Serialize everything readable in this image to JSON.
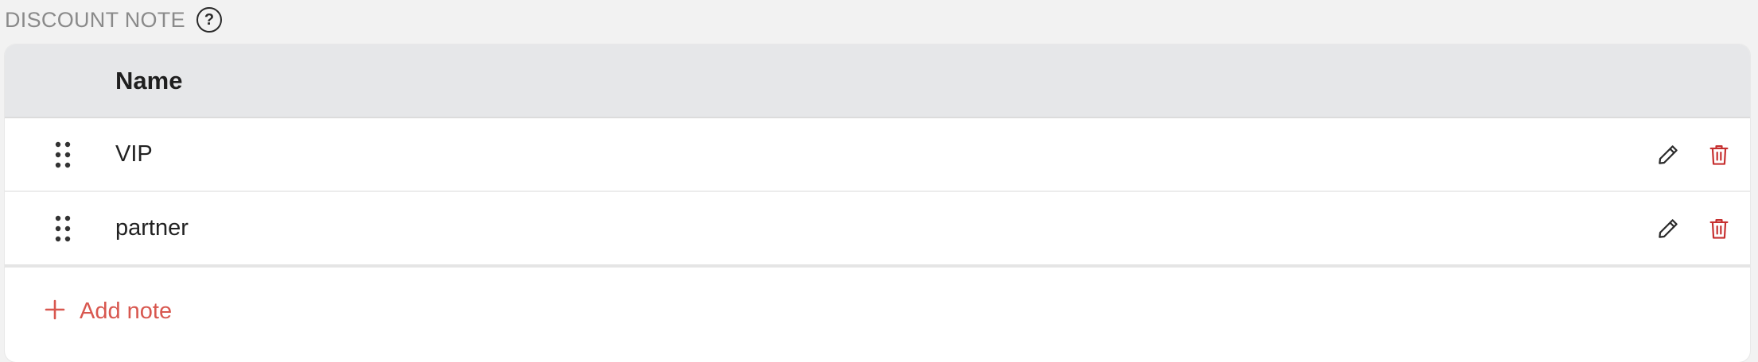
{
  "section": {
    "title": "DISCOUNT NOTE",
    "help_symbol": "?"
  },
  "table": {
    "column_name": "Name",
    "rows": [
      {
        "name": "VIP"
      },
      {
        "name": "partner"
      }
    ]
  },
  "add_button": {
    "plus": "+",
    "label": "Add note"
  },
  "colors": {
    "accent": "#d8574f",
    "delete": "#c62f2f",
    "header_bg": "#e6e7e9"
  },
  "icons": {
    "drag": "drag-handle-icon",
    "edit": "pencil-icon",
    "delete": "trash-icon",
    "help": "question-circle-icon",
    "add": "plus-icon"
  }
}
